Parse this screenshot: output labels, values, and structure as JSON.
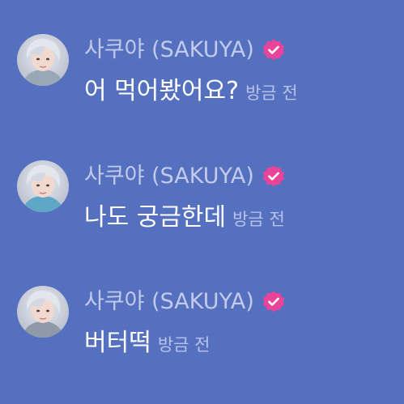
{
  "colors": {
    "background": "#5570bf",
    "name_text": "#c3cbec",
    "message_text": "#ffffff",
    "time_text": "#b8c2ea",
    "badge": "#e8459a"
  },
  "messages": [
    {
      "author": "사쿠야 (SAKUYA)",
      "verified_icon": "verified-badge-icon",
      "text": "어 먹어봤어요?",
      "time": "방금 전"
    },
    {
      "author": "사쿠야 (SAKUYA)",
      "verified_icon": "verified-badge-icon",
      "text": "나도 궁금한데",
      "time": "방금 전"
    },
    {
      "author": "사쿠야 (SAKUYA)",
      "verified_icon": "verified-badge-icon",
      "text": "버터떡",
      "time": "방금 전"
    }
  ]
}
